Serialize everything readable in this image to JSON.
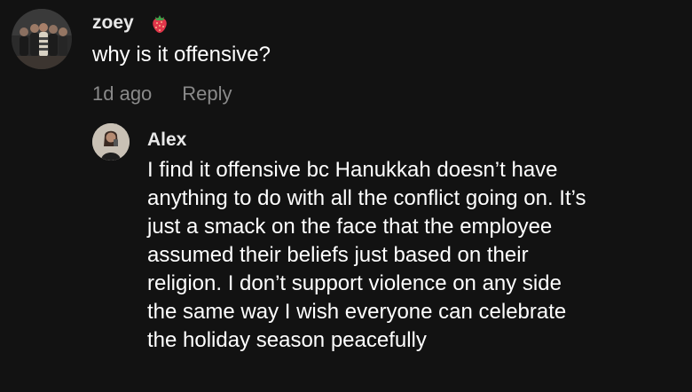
{
  "comment": {
    "author": "zoey",
    "author_badge_icon": "strawberry-icon",
    "text": "why is it offensive?",
    "timestamp": "1d ago",
    "reply_label": "Reply"
  },
  "reply": {
    "author": "Alex",
    "text": "I find it offensive bc Hanukkah doesn’t have\nanything to do with all the conflict going on. It’s\njust a smack on the face that the employee\nassumed their beliefs just based on their\nreligion. I don’t support violence on any side\nthe same way I wish everyone can celebrate\nthe holiday season peacefully"
  },
  "colors": {
    "background": "#121212",
    "text_primary": "#ffffff",
    "text_secondary": "#8a8a8a"
  }
}
